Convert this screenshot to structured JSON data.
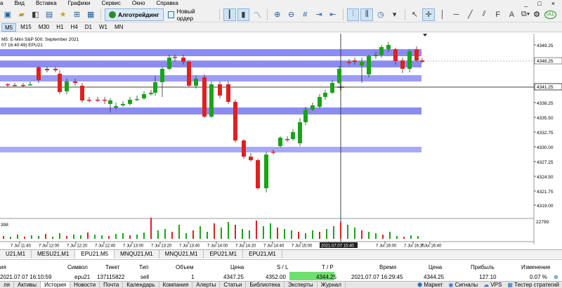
{
  "menu": {
    "items": [
      "а",
      "Вид",
      "Вставка",
      "Графики",
      "Сервис",
      "Окно",
      "Справка"
    ],
    "win_min": "_",
    "win_max": "□",
    "win_close": "×"
  },
  "toolbar": {
    "algo_label": "Алготрейдинг",
    "new_order_label": "Новый ордер",
    "icons": [
      "new-chart-icon",
      "folder-icon",
      "profiles-icon",
      "market-watch-icon",
      "navigator-icon",
      "data-window-icon",
      "tester-icon",
      "algo-icon",
      "new-order-icon",
      "bar-chart-icon",
      "candles-icon",
      "line-chart-icon",
      "zoom-in-icon",
      "zoom-out-icon",
      "grid-icon",
      "autoscroll-icon",
      "chart-shift-icon",
      "indicators-icon",
      "templates-icon",
      "periods-icon",
      "cursor-icon",
      "crosshair-icon",
      "vertical-line-icon",
      "horizontal-line-icon",
      "trendline-icon",
      "channel-icon",
      "fibo-icon",
      "text-icon",
      "shapes-icon"
    ],
    "status_label": "ULL"
  },
  "timeframes": {
    "items": [
      "M5",
      "M15",
      "M30",
      "H1",
      "H4",
      "D1",
      "W1",
      "MN"
    ],
    "active": "M5"
  },
  "chart": {
    "title_line1": "M5:  E-Mini S&P 500: September 2021",
    "title_line2": "07 16:40:49) EPU21",
    "price_labels": [
      "4349.25",
      "4348.25",
      "4341.25",
      "4338.25",
      "4335.50",
      "4332.75",
      "4330.00",
      "4327.25",
      "4324.50",
      "4321.75",
      "4319.00"
    ],
    "current_price": "4348.25",
    "cross_price": "4341.25",
    "time_labels": [
      "7 Jul 11:40",
      "7 Jul 12:00",
      "7 Jul 12:20",
      "7 Jul 12:40",
      "7 Jul 13:00",
      "7 Jul 13:20",
      "7 Jul 13:40",
      "7 Jul 14:00",
      "7 Jul 14:20",
      "7 Jul 14:40",
      "7 Jul 15:00",
      "7 Jul 15:20",
      "7 Jul 16:00",
      "7 Jul 16:20",
      "7 Jul 16:40"
    ],
    "cross_time": "2021.07.07 15:40",
    "volume_max": "22799",
    "volume_left": "398",
    "colors": {
      "bull": "#1aa31a",
      "bear": "#e02020",
      "zone": "#8b8bf5",
      "grid": "#d8d8d8"
    }
  },
  "chart_tabs": {
    "items": [
      "U21,M1",
      "MESU21,M1",
      "EPU21,M5",
      "MNQU21,M1",
      "MNQU21,M1",
      "EPU21,M1",
      "EPU21,M1"
    ],
    "active": "EPU21,M5"
  },
  "trade_table": {
    "headers": {
      "symbol": "Символ",
      "ticket": "Тикет",
      "type": "Тип",
      "volume": "Объем",
      "price": "Цена",
      "sl": "S / L",
      "tp": "T / P",
      "time": "Время",
      "price2": "Цена",
      "profit": "Прибыль",
      "change": "Изменение",
      "first": "ия"
    },
    "row": {
      "open_time": "2021.07.07 16:10:59",
      "symbol": "epu21",
      "ticket": "137115822",
      "type": "sell",
      "volume": "1",
      "price": "4347.25",
      "sl": "4352.00",
      "tp": "4344.25",
      "time": "2021.07.07 16:29:45",
      "price2": "4344.25",
      "profit": "127.10",
      "change": "0.07 %"
    }
  },
  "bottom_tabs": {
    "items": [
      "ля",
      "Активы",
      "История",
      "Новости",
      "Почта",
      "Календарь",
      "Компания",
      "Алерты",
      "Статьи",
      "Библиотека",
      "Эксперты",
      "Журнал"
    ],
    "active": "История",
    "right": [
      "Маркет",
      "Сигналы",
      "VPS",
      "Тестер стратегий"
    ]
  }
}
